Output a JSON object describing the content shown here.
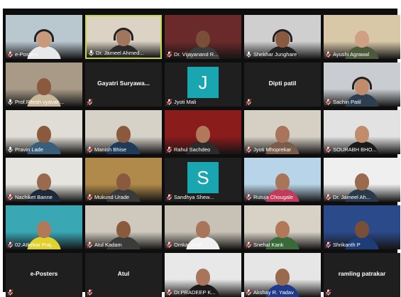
{
  "meeting": {
    "participants": [
      {
        "name": "e-Posters",
        "muted": true,
        "video": true,
        "skin": "#c99a7a",
        "shirt": "#e8e8e8",
        "bg": "#b9c7cf",
        "headset": true
      },
      {
        "name": "Dr. Jameel Ahmed...",
        "muted": false,
        "video": true,
        "active": true,
        "skin": "#a0775c",
        "shirt": "#2a2a2a",
        "bg": "#dcd3c4",
        "headset": true
      },
      {
        "name": "Dr. Vijayanand R...",
        "muted": true,
        "video": true,
        "skin": "#7a4f38",
        "shirt": "#3a3a3a",
        "bg": "#6b2a2a"
      },
      {
        "name": "Shekhar Junghare",
        "muted": false,
        "video": true,
        "skin": "#8a5a3e",
        "shirt": "#222222",
        "bg": "#cfcfcf",
        "headset": true
      },
      {
        "name": "Ayushi Agrawal",
        "muted": true,
        "video": true,
        "skin": "#d0a084",
        "shirt": "#4a5a3a",
        "bg": "#d8c8a8"
      },
      {
        "name": "Prof.Ritesh vyavah...",
        "muted": false,
        "video": true,
        "skin": "#8a5a3e",
        "shirt": "#c9b79a",
        "bg": "#a89a86"
      },
      {
        "name": "Gayatri Suryawa...",
        "muted": true,
        "video": false
      },
      {
        "name": "Jyoti Mali",
        "muted": true,
        "video": false,
        "initial": "J"
      },
      {
        "name": "Dipti patil",
        "muted": true,
        "video": false
      },
      {
        "name": "Sachin Patil",
        "muted": true,
        "video": true,
        "skin": "#c08c6c",
        "shirt": "#2c3e50",
        "bg": "#c9cdd1",
        "headset": true
      },
      {
        "name": "Pravin Lade",
        "muted": false,
        "video": true,
        "skin": "#8a5a3e",
        "shirt": "#3a5f7a",
        "bg": "#e0ddd6"
      },
      {
        "name": "Manish Bhise",
        "muted": true,
        "video": true,
        "skin": "#8a5a3e",
        "shirt": "#1f3b5a",
        "bg": "#d7d2c8"
      },
      {
        "name": "Rahul Sachdeo",
        "muted": true,
        "video": true,
        "skin": "#b07a5a",
        "shirt": "#2b2b2b",
        "bg": "#8a1c1c"
      },
      {
        "name": "Jyoti Mhoprekar",
        "muted": true,
        "video": true,
        "skin": "#a8745a",
        "shirt": "#7a5c4a",
        "bg": "#d6d0c4"
      },
      {
        "name": "SOURABH BHO...",
        "muted": true,
        "video": true,
        "skin": "#c08c6c",
        "shirt": "#1a1a1a",
        "bg": "#e2e2e2"
      },
      {
        "name": "Nachiket Banne",
        "muted": true,
        "video": true,
        "skin": "#9a6a4e",
        "shirt": "#1e2a3a",
        "bg": "#e6e4df"
      },
      {
        "name": "Mukund Urade",
        "muted": true,
        "video": true,
        "skin": "#8a5a3e",
        "shirt": "#3a3a3a",
        "bg": "#b08a4a"
      },
      {
        "name": "Sandhya Shew...",
        "muted": true,
        "video": false,
        "initial": "S"
      },
      {
        "name": "Rutuja Chougale",
        "muted": true,
        "video": true,
        "skin": "#a8745a",
        "shirt": "#c23b5c",
        "bg": "#b7d4e8"
      },
      {
        "name": "Dr. Jameel Ah...",
        "muted": true,
        "video": true,
        "skin": "#9a6a4e",
        "shirt": "#2a3a4a",
        "bg": "#efefef"
      },
      {
        "name": "02.Atkekar Praj...",
        "muted": true,
        "video": true,
        "skin": "#b07a5a",
        "shirt": "#e2d12a",
        "bg": "#3aa7b5"
      },
      {
        "name": "Atul Kadam",
        "muted": true,
        "video": true,
        "skin": "#8a5a3e",
        "shirt": "#3b3b3b",
        "bg": "#cfc8bc"
      },
      {
        "name": "Omkar Patil",
        "muted": true,
        "video": true,
        "skin": "#a8745a",
        "shirt": "#f0f0f0",
        "bg": "#c8c2b6"
      },
      {
        "name": "Snehal Kank",
        "muted": true,
        "video": true,
        "skin": "#b07a5a",
        "shirt": "#3a6a3a",
        "bg": "#d8d2c6"
      },
      {
        "name": "Shrikanth P",
        "muted": true,
        "video": true,
        "skin": "#7a4f38",
        "shirt": "#1e3c78",
        "bg": "#2a4a8a"
      },
      {
        "name": "e-Posters",
        "muted": true,
        "video": false
      },
      {
        "name": "Atul",
        "muted": true,
        "video": false
      },
      {
        "name": "Dr.PRADEEP K...",
        "muted": true,
        "video": true,
        "skin": "#a8745a",
        "shirt": "#1a1a1a",
        "bg": "#e8e8e8"
      },
      {
        "name": "Akshay R. Yadav",
        "muted": true,
        "video": true,
        "skin": "#9a6a4e",
        "shirt": "#1e3a8a",
        "bg": "#e6e6e6"
      },
      {
        "name": "ramling patrakar",
        "muted": true,
        "video": false
      }
    ]
  }
}
